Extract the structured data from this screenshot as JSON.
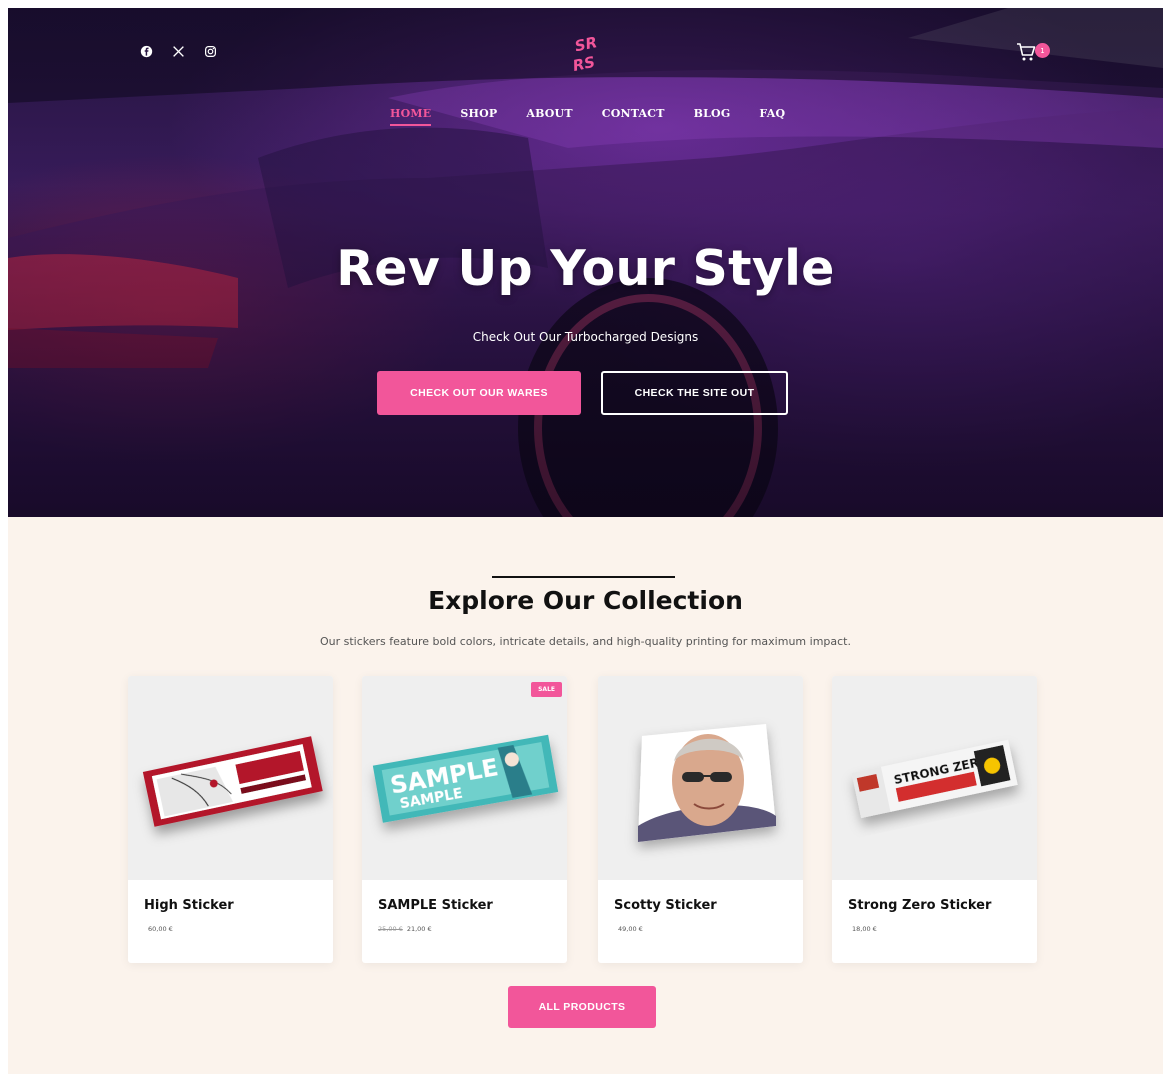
{
  "header": {
    "social": [
      {
        "icon": "facebook-icon",
        "glyph": "f"
      },
      {
        "icon": "x-twitter-icon",
        "glyph": "𝕏"
      },
      {
        "icon": "instagram-icon",
        "glyph": "◎"
      }
    ],
    "logo_text": "SR RS",
    "cart_count": "1",
    "nav": [
      "HOME",
      "SHOP",
      "ABOUT",
      "CONTACT",
      "BLOG",
      "FAQ"
    ],
    "active_nav": "HOME"
  },
  "hero": {
    "title": "Rev Up Your Style",
    "subtitle": "Check Out Our Turbocharged Designs",
    "primary_button": "CHECK OUT OUR WARES",
    "secondary_button": "CHECK THE SITE OUT"
  },
  "collection": {
    "title": "Explore Our Collection",
    "description": "Our stickers feature bold colors, intricate details, and high-quality printing for maximum impact.",
    "products": [
      {
        "name": "High Sticker",
        "old_price": "",
        "price": "60,00 €",
        "sale": ""
      },
      {
        "name": "SAMPLE Sticker",
        "old_price": "25,00 €",
        "price": "21,00 €",
        "sale": "SALE"
      },
      {
        "name": "Scotty Sticker",
        "old_price": "",
        "price": "49,00 €",
        "sale": ""
      },
      {
        "name": "Strong Zero Sticker",
        "old_price": "",
        "price": "18,00 €",
        "sale": ""
      }
    ],
    "sticker_texts": {
      "sample_big": "SAMPLE",
      "sample_small": "SAMPLE",
      "strong_zero": "STRONG ZERO"
    },
    "all_products_button": "ALL PRODUCTS"
  },
  "colors": {
    "accent": "#f2569a",
    "background": "#fbf3ec",
    "text": "#111111"
  }
}
